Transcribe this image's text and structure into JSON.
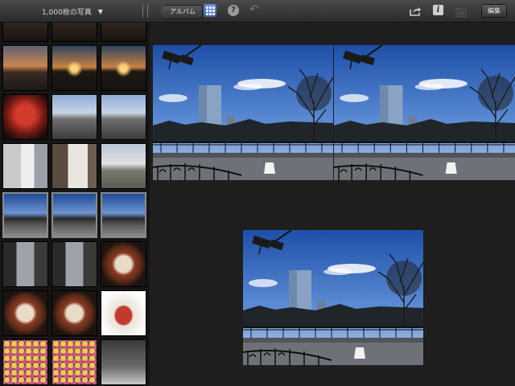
{
  "toolbar": {
    "library_title": "1,000枚の写真",
    "album_label": "アルバム",
    "edit_label": "編集",
    "help_glyph": "?",
    "undo_glyph": "↶",
    "info_glyph": "i",
    "dropdown_glyph": "▼",
    "icons": [
      "chevron-down-icon",
      "album-back-icon",
      "grid-icon",
      "help-icon",
      "undo-icon",
      "share-icon",
      "info-icon",
      "film-icon"
    ]
  },
  "thumbnails": [
    {
      "theme": "dark"
    },
    {
      "theme": "dark"
    },
    {
      "theme": "dark"
    },
    {
      "theme": "dusk"
    },
    {
      "theme": "sun"
    },
    {
      "theme": "sun"
    },
    {
      "theme": "red"
    },
    {
      "theme": "city"
    },
    {
      "theme": "city"
    },
    {
      "theme": "bld"
    },
    {
      "theme": "wed"
    },
    {
      "theme": "park"
    },
    {
      "theme": "sky",
      "selected": true
    },
    {
      "theme": "sky",
      "selected": true
    },
    {
      "theme": "sky",
      "selected": true
    },
    {
      "theme": "road"
    },
    {
      "theme": "road"
    },
    {
      "theme": "food"
    },
    {
      "theme": "food"
    },
    {
      "theme": "food"
    },
    {
      "theme": "jar"
    },
    {
      "theme": "game"
    },
    {
      "theme": "game"
    },
    {
      "theme": "lamp"
    }
  ],
  "colors": {
    "toolbar_top": "#4a4a4c",
    "toolbar_bottom": "#2b2b2d",
    "accent_blue": "#4d72c3",
    "background": "#1e1e1f"
  },
  "compare_photos": [
    "photo-left",
    "photo-right",
    "photo-bottom"
  ]
}
